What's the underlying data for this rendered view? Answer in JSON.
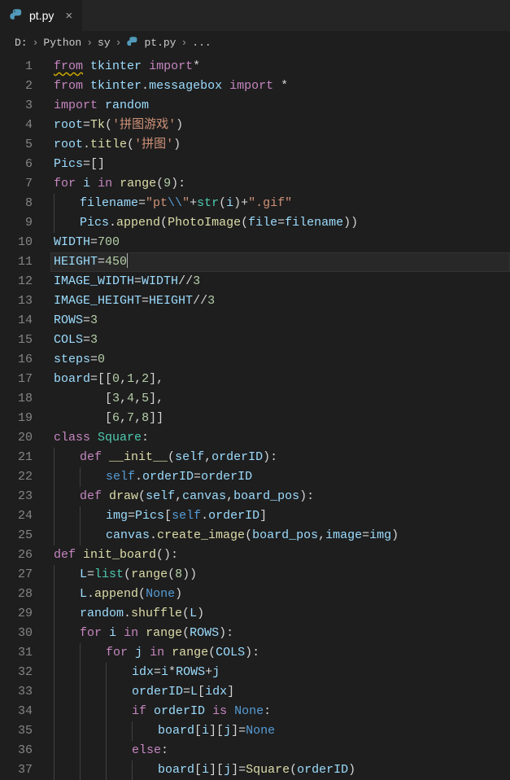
{
  "tab": {
    "filename": "pt.py"
  },
  "breadcrumb": {
    "drive": "D:",
    "folder1": "Python",
    "folder2": "sy",
    "file": "pt.py",
    "tail": "..."
  },
  "python_icon": "python-icon",
  "code_lines": [
    {
      "n": 1,
      "html": "<span class='kw squiggle'>from</span> <span class='var'>tkinter</span> <span class='kw'>import</span><span class='op'>*</span>"
    },
    {
      "n": 2,
      "html": "<span class='kw'>from</span> <span class='var'>tkinter</span>.<span class='var'>messagebox</span> <span class='kw'>import</span> <span class='op'>*</span>"
    },
    {
      "n": 3,
      "html": "<span class='kw'>import</span> <span class='var'>random</span>"
    },
    {
      "n": 4,
      "html": "<span class='var'>root</span><span class='op'>=</span><span class='fn'>Tk</span>(<span class='str'>'拼图游戏'</span>)"
    },
    {
      "n": 5,
      "html": "<span class='var'>root</span>.<span class='fn'>title</span>(<span class='str'>'拼图'</span>)"
    },
    {
      "n": 6,
      "html": "<span class='var'>Pics</span><span class='op'>=</span>[]"
    },
    {
      "n": 7,
      "html": "<span class='kw'>for</span> <span class='var'>i</span> <span class='kw'>in</span> <span class='fn'>range</span>(<span class='num'>9</span>):"
    },
    {
      "n": 8,
      "guides": 1,
      "html": "<span class='var'>filename</span><span class='op'>=</span><span class='str'>\"pt<span class='con'>\\\\</span>\"</span><span class='op'>+</span><span class='cls'>str</span>(<span class='var'>i</span>)<span class='op'>+</span><span class='str'>\".gif\"</span>"
    },
    {
      "n": 9,
      "guides": 1,
      "html": "<span class='var'>Pics</span>.<span class='fn'>append</span>(<span class='fn'>PhotoImage</span>(<span class='var'>file</span><span class='op'>=</span><span class='var'>filename</span>))"
    },
    {
      "n": 10,
      "html": "<span class='var'>WIDTH</span><span class='op'>=</span><span class='num'>700</span>"
    },
    {
      "n": 11,
      "current": true,
      "html": "<span class='var'>HEIGHT</span><span class='op'>=</span><span class='num'>450</span><span class='cursor'></span>"
    },
    {
      "n": 12,
      "html": "<span class='var'>IMAGE_WIDTH</span><span class='op'>=</span><span class='var'>WIDTH</span><span class='op'>//</span><span class='num'>3</span>"
    },
    {
      "n": 13,
      "html": "<span class='var'>IMAGE_HEIGHT</span><span class='op'>=</span><span class='var'>HEIGHT</span><span class='op'>//</span><span class='num'>3</span>"
    },
    {
      "n": 14,
      "html": "<span class='var'>ROWS</span><span class='op'>=</span><span class='num'>3</span>"
    },
    {
      "n": 15,
      "html": "<span class='var'>COLS</span><span class='op'>=</span><span class='num'>3</span>"
    },
    {
      "n": 16,
      "html": "<span class='var'>steps</span><span class='op'>=</span><span class='num'>0</span>"
    },
    {
      "n": 17,
      "html": "<span class='var'>board</span><span class='op'>=</span>[[<span class='num'>0</span>,<span class='num'>1</span>,<span class='num'>2</span>],"
    },
    {
      "n": 18,
      "html": "       [<span class='num'>3</span>,<span class='num'>4</span>,<span class='num'>5</span>],"
    },
    {
      "n": 19,
      "html": "       [<span class='num'>6</span>,<span class='num'>7</span>,<span class='num'>8</span>]]"
    },
    {
      "n": 20,
      "html": "<span class='kw'>class</span> <span class='cls'>Square</span>:"
    },
    {
      "n": 21,
      "guides": 1,
      "html": "<span class='kw'>def</span> <span class='fn'>__init__</span>(<span class='var'>self</span>,<span class='var'>orderID</span>):"
    },
    {
      "n": 22,
      "guides": 2,
      "html": "<span class='con'>self</span>.<span class='var'>orderID</span><span class='op'>=</span><span class='var'>orderID</span>"
    },
    {
      "n": 23,
      "guides": 1,
      "html": "<span class='kw'>def</span> <span class='fn'>draw</span>(<span class='var'>self</span>,<span class='var'>canvas</span>,<span class='var'>board_pos</span>):"
    },
    {
      "n": 24,
      "guides": 2,
      "html": "<span class='var'>img</span><span class='op'>=</span><span class='var'>Pics</span>[<span class='con'>self</span>.<span class='var'>orderID</span>]"
    },
    {
      "n": 25,
      "guides": 2,
      "html": "<span class='var'>canvas</span>.<span class='fn'>create_image</span>(<span class='var'>board_pos</span>,<span class='var'>image</span><span class='op'>=</span><span class='var'>img</span>)"
    },
    {
      "n": 26,
      "html": "<span class='kw'>def</span> <span class='fn'>init_board</span>():"
    },
    {
      "n": 27,
      "guides": 1,
      "html": "<span class='var'>L</span><span class='op'>=</span><span class='cls'>list</span>(<span class='fn'>range</span>(<span class='num'>8</span>))"
    },
    {
      "n": 28,
      "guides": 1,
      "html": "<span class='var'>L</span>.<span class='fn'>append</span>(<span class='con'>None</span>)"
    },
    {
      "n": 29,
      "guides": 1,
      "html": "<span class='var'>random</span>.<span class='fn'>shuffle</span>(<span class='var'>L</span>)"
    },
    {
      "n": 30,
      "guides": 1,
      "html": "<span class='kw'>for</span> <span class='var'>i</span> <span class='kw'>in</span> <span class='fn'>range</span>(<span class='var'>ROWS</span>):"
    },
    {
      "n": 31,
      "guides": 2,
      "html": "<span class='kw'>for</span> <span class='var'>j</span> <span class='kw'>in</span> <span class='fn'>range</span>(<span class='var'>COLS</span>):"
    },
    {
      "n": 32,
      "guides": 3,
      "html": "<span class='var'>idx</span><span class='op'>=</span><span class='var'>i</span><span class='op'>*</span><span class='var'>ROWS</span><span class='op'>+</span><span class='var'>j</span>"
    },
    {
      "n": 33,
      "guides": 3,
      "html": "<span class='var'>orderID</span><span class='op'>=</span><span class='var'>L</span>[<span class='var'>idx</span>]"
    },
    {
      "n": 34,
      "guides": 3,
      "html": "<span class='kw'>if</span> <span class='var'>orderID</span> <span class='kw'>is</span> <span class='con'>None</span>:"
    },
    {
      "n": 35,
      "guides": 4,
      "html": "<span class='var'>board</span>[<span class='var'>i</span>][<span class='var'>j</span>]<span class='op'>=</span><span class='con'>None</span>"
    },
    {
      "n": 36,
      "guides": 3,
      "html": "<span class='kw'>else</span>:"
    },
    {
      "n": 37,
      "guides": 4,
      "html": "<span class='var'>board</span>[<span class='var'>i</span>][<span class='var'>j</span>]<span class='op'>=</span><span class='fn'>Square</span>(<span class='var'>orderID</span>)"
    }
  ]
}
